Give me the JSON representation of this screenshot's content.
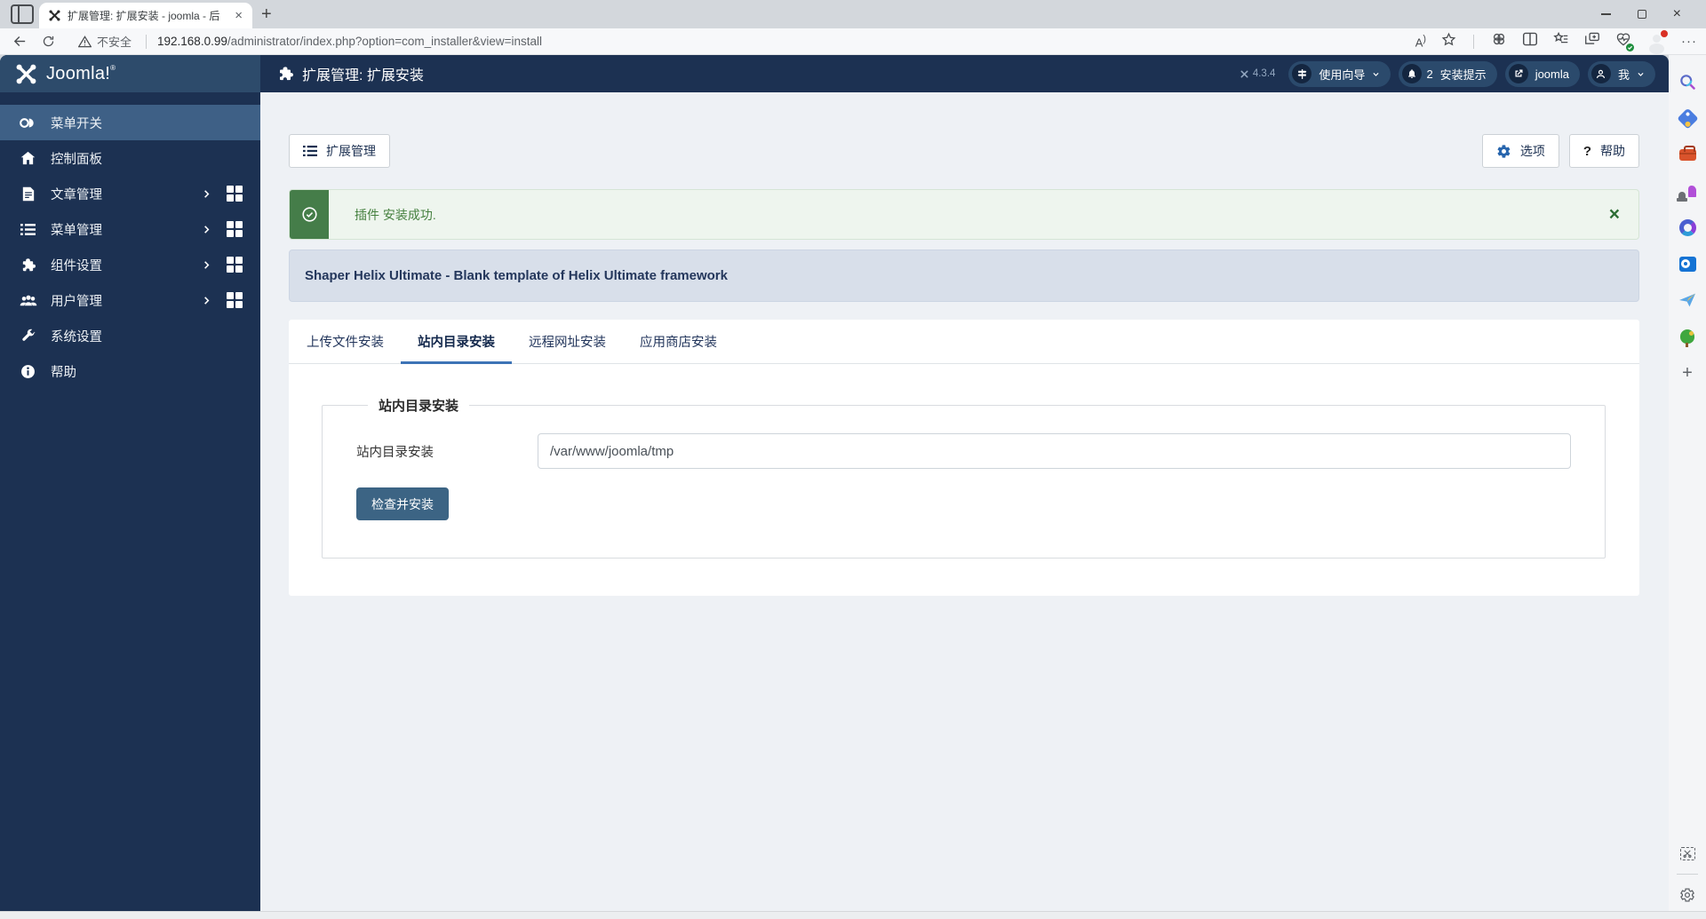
{
  "browser": {
    "tab_title": "扩展管理: 扩展安装 - joomla - 后",
    "tab_close": "×",
    "new_tab": "+",
    "window_close": "×",
    "security_label": "不安全",
    "url_host": "192.168.0.99",
    "url_path": "/administrator/index.php?option=com_installer&view=install",
    "read_aloud_label": "A",
    "more_menu": "···"
  },
  "joomla": {
    "logo_text": "Joomla!",
    "logo_reg": "®",
    "page_title": "扩展管理: 扩展安装",
    "version": "4.3.4",
    "pills": {
      "guide_label": "使用向导",
      "notification_count": "2",
      "notification_label": "安装提示",
      "site_label": "joomla",
      "user_label": "我"
    },
    "sidebar": [
      {
        "label": "菜单开关"
      },
      {
        "label": "控制面板"
      },
      {
        "label": "文章管理"
      },
      {
        "label": "菜单管理"
      },
      {
        "label": "组件设置"
      },
      {
        "label": "用户管理"
      },
      {
        "label": "系统设置"
      },
      {
        "label": "帮助"
      }
    ],
    "toolbar": {
      "extensions_button": "扩展管理",
      "options_button": "选项",
      "help_button": "帮助"
    },
    "alert": {
      "message": "插件 安装成功.",
      "close": "×"
    },
    "banner": "Shaper Helix Ultimate - Blank template of Helix Ultimate framework",
    "tabs": [
      {
        "label": "上传文件安装"
      },
      {
        "label": "站内目录安装"
      },
      {
        "label": "远程网址安装"
      },
      {
        "label": "应用商店安装"
      }
    ],
    "form": {
      "legend": "站内目录安装",
      "label": "站内目录安装",
      "value": "/var/www/joomla/tmp",
      "submit": "检查并安装"
    },
    "colors": {
      "header_dark": "#1c3152",
      "header_light": "#2d4b6b",
      "sidebar_active": "#3e6086",
      "accent_blue": "#3d74b6",
      "success_green": "#457d49",
      "submit_blue": "#3c6484"
    }
  },
  "edge_sidebar": {
    "add": "+"
  }
}
